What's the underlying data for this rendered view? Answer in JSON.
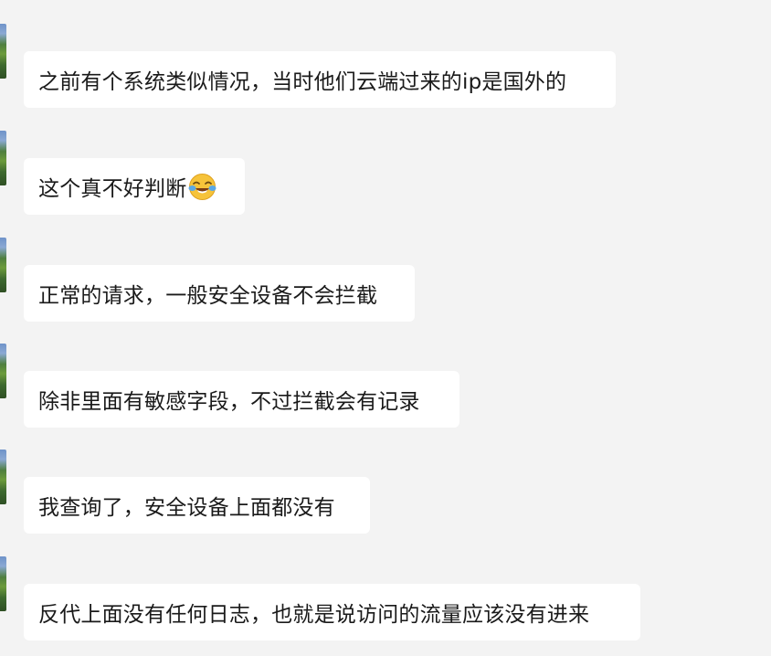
{
  "messages": [
    {
      "text": "之前有个系统类似情况，当时他们云端过来的ip是国外的"
    },
    {
      "text": "这个真不好判断",
      "emoji": "face-with-tears-of-joy-icon"
    },
    {
      "text": "正常的请求，一般安全设备不会拦截"
    },
    {
      "text": "除非里面有敏感字段，不过拦截会有记录"
    },
    {
      "text": "我查询了，安全设备上面都没有"
    },
    {
      "text": "反代上面没有任何日志，也就是说访问的流量应该没有进来"
    }
  ]
}
